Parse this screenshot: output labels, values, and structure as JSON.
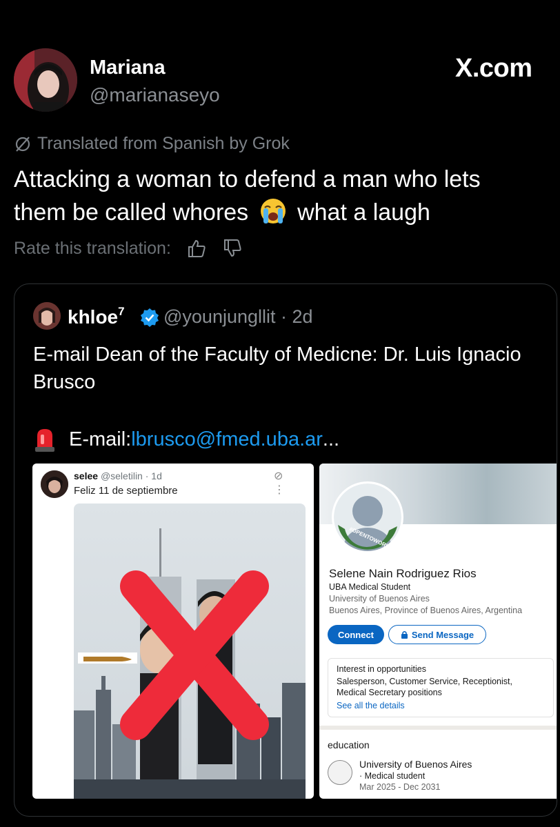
{
  "header": {
    "name": "Mariana",
    "handle": "@marianaseyo",
    "site": "X.com"
  },
  "translation": {
    "notice": "Translated from Spanish by Grok",
    "text_before_emoji": "Attacking a woman to defend a man who lets them be called whores",
    "emoji": "loudly-crying-face",
    "text_after_emoji": "what a laugh",
    "rate_label": "Rate this translation:"
  },
  "quote": {
    "name": "khloe",
    "name_superscript": "7",
    "handle_time": "@younjungllit · 2d",
    "text": "E-mail Dean of the Faculty of Medicne: Dr. Luis Ignacio Brusco",
    "email_label": "E-mail: ",
    "email_link": "lbrusco@fmed.uba.ar",
    "ellipsis": "..."
  },
  "embedded_tweet": {
    "name": "selee",
    "handle_time": "@seletilin · 1d",
    "text": "Feliz 11 de septiembre",
    "icons": "⊘ ⋮"
  },
  "linkedin": {
    "badge": "#OPENTOWORK",
    "name": "Selene Nain Rodriguez Rios",
    "headline": "UBA Medical Student",
    "school": "University of Buenos Aires",
    "location": "Buenos Aires, Province of Buenos Aires, Argentina",
    "connect_label": "Connect",
    "message_label": "Send Message",
    "box_title": "Interest in opportunities",
    "box_body": "Salesperson, Customer Service, Receptionist, Medical Secretary positions",
    "box_link": "See all the details",
    "education_header": "education",
    "edu_school": "University of Buenos Aires",
    "edu_degree": "· Medical student",
    "edu_dates": "Mar 2025 - Dec 2031"
  },
  "colors": {
    "background": "#000000",
    "link": "#1d9bf0",
    "linkedin_blue": "#0a66c2",
    "cross_red": "#ee2b3a"
  }
}
